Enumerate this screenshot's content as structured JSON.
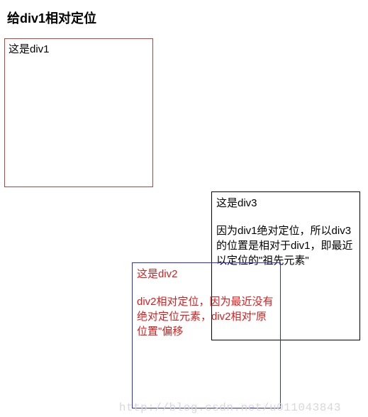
{
  "heading": "给div1相对定位",
  "div1": {
    "label": "这是div1"
  },
  "div2": {
    "label": "这是div2",
    "desc": "div2相对定位，因为最近没有绝对定位元素，div2相对\"原位置\"偏移"
  },
  "div3": {
    "label": "这是div3",
    "desc": "因为div1绝对定位，所以div3的位置是相对于div1，即最近以定位的\"祖先元素\""
  },
  "watermark": "http://blog.csdn.net/u011043843"
}
